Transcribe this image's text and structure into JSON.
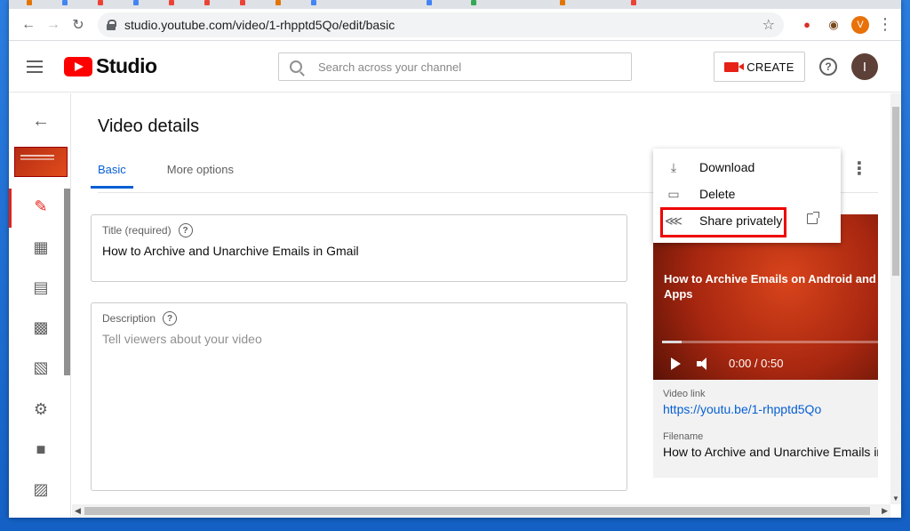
{
  "browser": {
    "url": "studio.youtube.com/video/1-rhpptd5Qo/edit/basic",
    "profile_initial": "V"
  },
  "header": {
    "logo_text": "Studio",
    "search_placeholder": "Search across your channel",
    "create_label": "CREATE",
    "help_glyph": "?",
    "avatar_initial": "I"
  },
  "page": {
    "title": "Video details",
    "tabs": [
      {
        "label": "Basic",
        "active": true
      },
      {
        "label": "More options",
        "active": false
      }
    ]
  },
  "form": {
    "title_label": "Title (required)",
    "title_value": "How to Archive and Unarchive Emails in Gmail",
    "description_label": "Description",
    "description_placeholder": "Tell viewers about your video"
  },
  "menu": {
    "items": [
      {
        "label": "Download",
        "icon": "download-icon"
      },
      {
        "label": "Delete",
        "icon": "trash-icon"
      },
      {
        "label": "Share privately",
        "icon": "share-icon"
      }
    ]
  },
  "player": {
    "overlay_title": "How to Archive Emails on Android and iOS Apps",
    "time": "0:00 / 0:50"
  },
  "info": {
    "video_link_label": "Video link",
    "video_link": "https://youtu.be/1-rhpptd5Qo",
    "filename_label": "Filename",
    "filename": "How to Archive and Unarchive Emails in G"
  },
  "colors": {
    "accent": "#065fd4",
    "brand": "#ff0000",
    "highlight": "#ee0000"
  }
}
